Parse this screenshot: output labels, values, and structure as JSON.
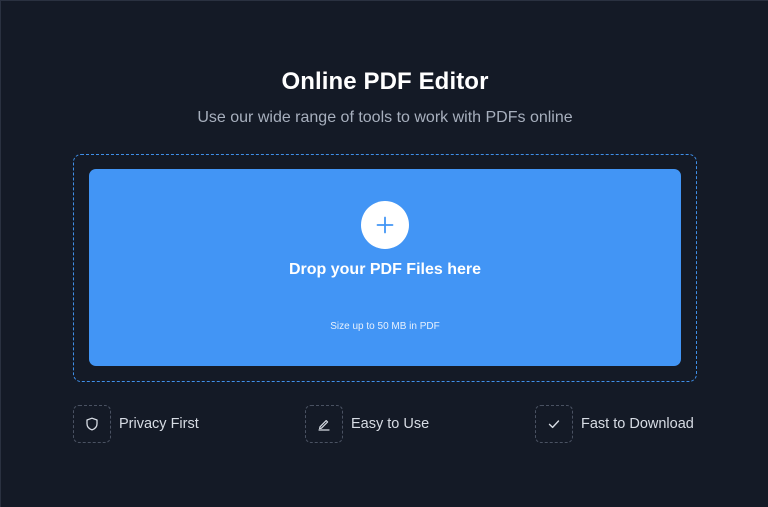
{
  "header": {
    "title": "Online PDF Editor",
    "subtitle": "Use our wide range of tools to work with PDFs online"
  },
  "dropzone": {
    "icon": "plus-icon",
    "title": "Drop your PDF Files here",
    "hint": "Size up to 50 MB in PDF"
  },
  "features": [
    {
      "icon": "shield-icon",
      "label": "Privacy First"
    },
    {
      "icon": "pencil-icon",
      "label": "Easy to Use"
    },
    {
      "icon": "checkmark-icon",
      "label": "Fast to Download"
    }
  ],
  "colors": {
    "background": "#141a26",
    "accent": "#4295f5",
    "dashed_border": "#3f8fe8"
  }
}
